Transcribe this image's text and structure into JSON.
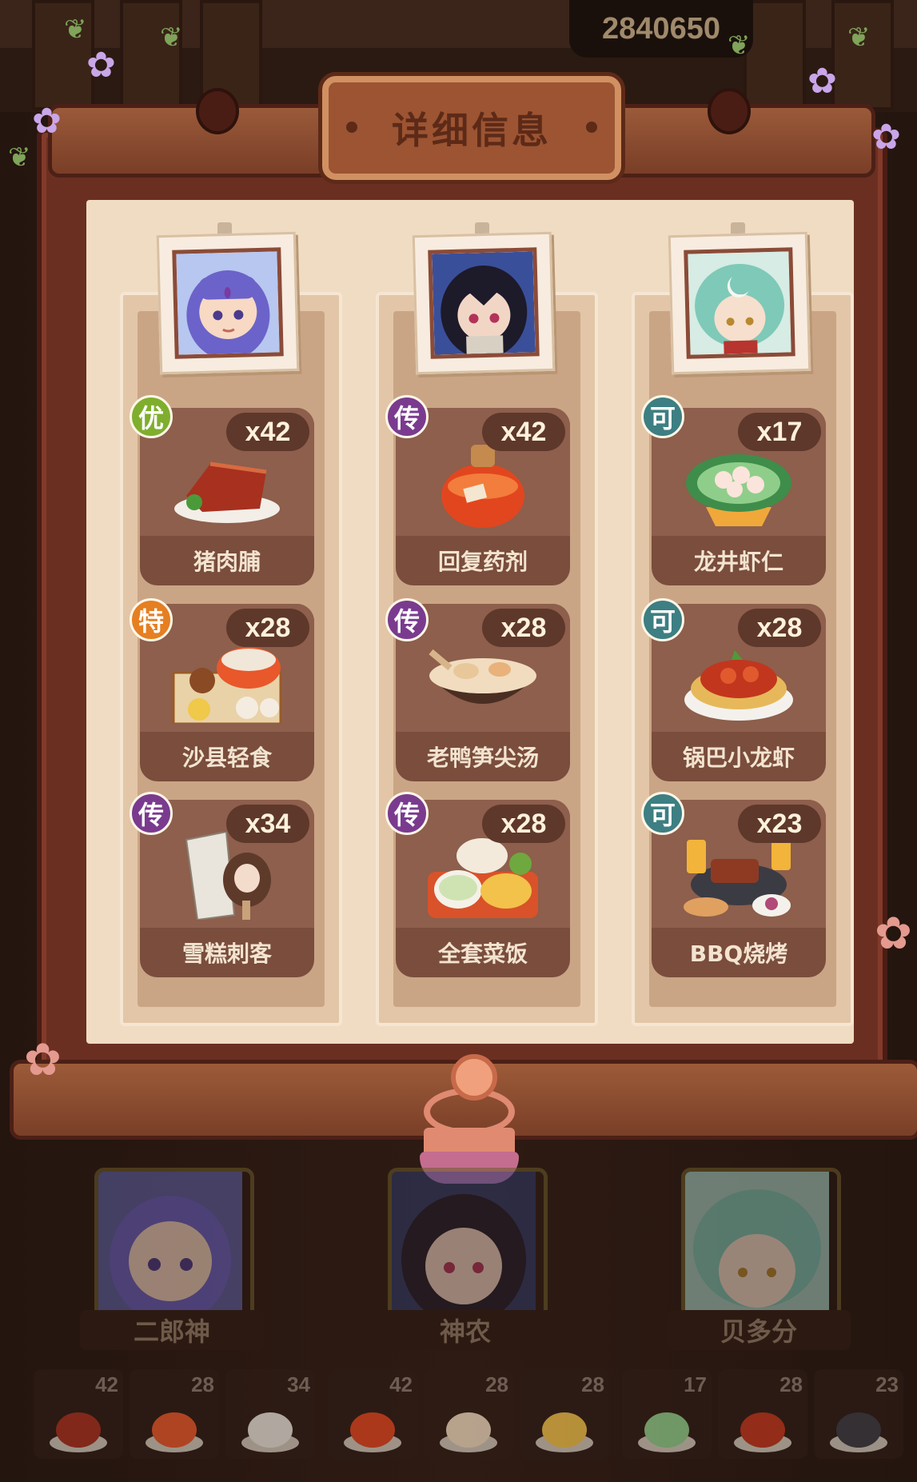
{
  "score_text": "2840650",
  "dialog": {
    "title": "详细信息"
  },
  "columns": [
    {
      "character": "二郎神",
      "portrait_colors": {
        "hair": "#6b63c9",
        "skin": "#f7d9c4",
        "bg": "#b7c7f0"
      },
      "items": [
        {
          "name": "猪肉脯",
          "qty": "x42",
          "grade": "优",
          "grade_color": "#7fae2e"
        },
        {
          "name": "沙县轻食",
          "qty": "x28",
          "grade": "特",
          "grade_color": "#e57f22"
        },
        {
          "name": "雪糕刺客",
          "qty": "x34",
          "grade": "传",
          "grade_color": "#7a3b8f"
        }
      ]
    },
    {
      "character": "神农",
      "portrait_colors": {
        "hair": "#1d1a2a",
        "skin": "#f2d6c5",
        "bg": "#3a4f9a"
      },
      "items": [
        {
          "name": "回复药剂",
          "qty": "x42",
          "grade": "传",
          "grade_color": "#7a3b8f"
        },
        {
          "name": "老鸭笋尖汤",
          "qty": "x28",
          "grade": "传",
          "grade_color": "#7a3b8f"
        },
        {
          "name": "全套菜饭",
          "qty": "x28",
          "grade": "传",
          "grade_color": "#7a3b8f"
        }
      ]
    },
    {
      "character": "贝多分",
      "portrait_colors": {
        "hair": "#7fc9b8",
        "skin": "#f6dfcd",
        "bg": "#d6ece4"
      },
      "items": [
        {
          "name": "龙井虾仁",
          "qty": "x17",
          "grade": "可",
          "grade_color": "#3d7f82"
        },
        {
          "name": "锅巴小龙虾",
          "qty": "x28",
          "grade": "可",
          "grade_color": "#3d7f82"
        },
        {
          "name": "BBQ烧烤",
          "qty": "x23",
          "grade": "可",
          "grade_color": "#3d7f82"
        }
      ]
    }
  ],
  "inventory": [
    {
      "count": "42",
      "food": "pork-jerky"
    },
    {
      "count": "28",
      "food": "shaxian-snack"
    },
    {
      "count": "34",
      "food": "ice-cream"
    },
    {
      "count": "42",
      "food": "potion"
    },
    {
      "count": "28",
      "food": "duck-soup"
    },
    {
      "count": "28",
      "food": "set-meal"
    },
    {
      "count": "17",
      "food": "shrimp"
    },
    {
      "count": "28",
      "food": "crayfish"
    },
    {
      "count": "23",
      "food": "bbq"
    }
  ]
}
